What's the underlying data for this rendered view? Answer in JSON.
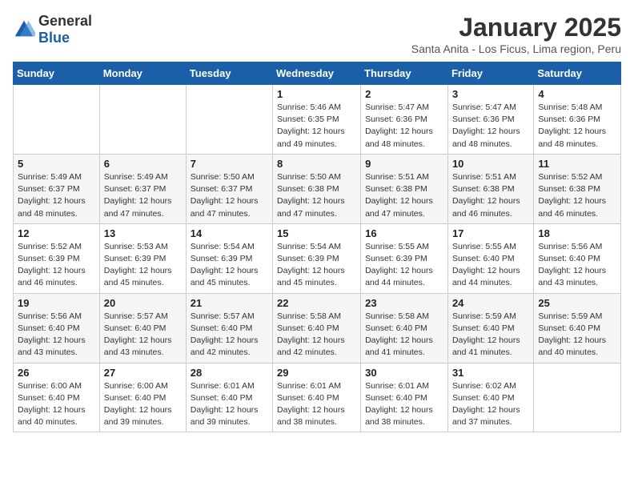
{
  "logo": {
    "general": "General",
    "blue": "Blue"
  },
  "title": "January 2025",
  "subtitle": "Santa Anita - Los Ficus, Lima region, Peru",
  "weekdays": [
    "Sunday",
    "Monday",
    "Tuesday",
    "Wednesday",
    "Thursday",
    "Friday",
    "Saturday"
  ],
  "weeks": [
    [
      {
        "day": "",
        "sunrise": "",
        "sunset": "",
        "daylight": ""
      },
      {
        "day": "",
        "sunrise": "",
        "sunset": "",
        "daylight": ""
      },
      {
        "day": "",
        "sunrise": "",
        "sunset": "",
        "daylight": ""
      },
      {
        "day": "1",
        "sunrise": "Sunrise: 5:46 AM",
        "sunset": "Sunset: 6:35 PM",
        "daylight": "Daylight: 12 hours and 49 minutes."
      },
      {
        "day": "2",
        "sunrise": "Sunrise: 5:47 AM",
        "sunset": "Sunset: 6:36 PM",
        "daylight": "Daylight: 12 hours and 48 minutes."
      },
      {
        "day": "3",
        "sunrise": "Sunrise: 5:47 AM",
        "sunset": "Sunset: 6:36 PM",
        "daylight": "Daylight: 12 hours and 48 minutes."
      },
      {
        "day": "4",
        "sunrise": "Sunrise: 5:48 AM",
        "sunset": "Sunset: 6:36 PM",
        "daylight": "Daylight: 12 hours and 48 minutes."
      }
    ],
    [
      {
        "day": "5",
        "sunrise": "Sunrise: 5:49 AM",
        "sunset": "Sunset: 6:37 PM",
        "daylight": "Daylight: 12 hours and 48 minutes."
      },
      {
        "day": "6",
        "sunrise": "Sunrise: 5:49 AM",
        "sunset": "Sunset: 6:37 PM",
        "daylight": "Daylight: 12 hours and 47 minutes."
      },
      {
        "day": "7",
        "sunrise": "Sunrise: 5:50 AM",
        "sunset": "Sunset: 6:37 PM",
        "daylight": "Daylight: 12 hours and 47 minutes."
      },
      {
        "day": "8",
        "sunrise": "Sunrise: 5:50 AM",
        "sunset": "Sunset: 6:38 PM",
        "daylight": "Daylight: 12 hours and 47 minutes."
      },
      {
        "day": "9",
        "sunrise": "Sunrise: 5:51 AM",
        "sunset": "Sunset: 6:38 PM",
        "daylight": "Daylight: 12 hours and 47 minutes."
      },
      {
        "day": "10",
        "sunrise": "Sunrise: 5:51 AM",
        "sunset": "Sunset: 6:38 PM",
        "daylight": "Daylight: 12 hours and 46 minutes."
      },
      {
        "day": "11",
        "sunrise": "Sunrise: 5:52 AM",
        "sunset": "Sunset: 6:38 PM",
        "daylight": "Daylight: 12 hours and 46 minutes."
      }
    ],
    [
      {
        "day": "12",
        "sunrise": "Sunrise: 5:52 AM",
        "sunset": "Sunset: 6:39 PM",
        "daylight": "Daylight: 12 hours and 46 minutes."
      },
      {
        "day": "13",
        "sunrise": "Sunrise: 5:53 AM",
        "sunset": "Sunset: 6:39 PM",
        "daylight": "Daylight: 12 hours and 45 minutes."
      },
      {
        "day": "14",
        "sunrise": "Sunrise: 5:54 AM",
        "sunset": "Sunset: 6:39 PM",
        "daylight": "Daylight: 12 hours and 45 minutes."
      },
      {
        "day": "15",
        "sunrise": "Sunrise: 5:54 AM",
        "sunset": "Sunset: 6:39 PM",
        "daylight": "Daylight: 12 hours and 45 minutes."
      },
      {
        "day": "16",
        "sunrise": "Sunrise: 5:55 AM",
        "sunset": "Sunset: 6:39 PM",
        "daylight": "Daylight: 12 hours and 44 minutes."
      },
      {
        "day": "17",
        "sunrise": "Sunrise: 5:55 AM",
        "sunset": "Sunset: 6:40 PM",
        "daylight": "Daylight: 12 hours and 44 minutes."
      },
      {
        "day": "18",
        "sunrise": "Sunrise: 5:56 AM",
        "sunset": "Sunset: 6:40 PM",
        "daylight": "Daylight: 12 hours and 43 minutes."
      }
    ],
    [
      {
        "day": "19",
        "sunrise": "Sunrise: 5:56 AM",
        "sunset": "Sunset: 6:40 PM",
        "daylight": "Daylight: 12 hours and 43 minutes."
      },
      {
        "day": "20",
        "sunrise": "Sunrise: 5:57 AM",
        "sunset": "Sunset: 6:40 PM",
        "daylight": "Daylight: 12 hours and 43 minutes."
      },
      {
        "day": "21",
        "sunrise": "Sunrise: 5:57 AM",
        "sunset": "Sunset: 6:40 PM",
        "daylight": "Daylight: 12 hours and 42 minutes."
      },
      {
        "day": "22",
        "sunrise": "Sunrise: 5:58 AM",
        "sunset": "Sunset: 6:40 PM",
        "daylight": "Daylight: 12 hours and 42 minutes."
      },
      {
        "day": "23",
        "sunrise": "Sunrise: 5:58 AM",
        "sunset": "Sunset: 6:40 PM",
        "daylight": "Daylight: 12 hours and 41 minutes."
      },
      {
        "day": "24",
        "sunrise": "Sunrise: 5:59 AM",
        "sunset": "Sunset: 6:40 PM",
        "daylight": "Daylight: 12 hours and 41 minutes."
      },
      {
        "day": "25",
        "sunrise": "Sunrise: 5:59 AM",
        "sunset": "Sunset: 6:40 PM",
        "daylight": "Daylight: 12 hours and 40 minutes."
      }
    ],
    [
      {
        "day": "26",
        "sunrise": "Sunrise: 6:00 AM",
        "sunset": "Sunset: 6:40 PM",
        "daylight": "Daylight: 12 hours and 40 minutes."
      },
      {
        "day": "27",
        "sunrise": "Sunrise: 6:00 AM",
        "sunset": "Sunset: 6:40 PM",
        "daylight": "Daylight: 12 hours and 39 minutes."
      },
      {
        "day": "28",
        "sunrise": "Sunrise: 6:01 AM",
        "sunset": "Sunset: 6:40 PM",
        "daylight": "Daylight: 12 hours and 39 minutes."
      },
      {
        "day": "29",
        "sunrise": "Sunrise: 6:01 AM",
        "sunset": "Sunset: 6:40 PM",
        "daylight": "Daylight: 12 hours and 38 minutes."
      },
      {
        "day": "30",
        "sunrise": "Sunrise: 6:01 AM",
        "sunset": "Sunset: 6:40 PM",
        "daylight": "Daylight: 12 hours and 38 minutes."
      },
      {
        "day": "31",
        "sunrise": "Sunrise: 6:02 AM",
        "sunset": "Sunset: 6:40 PM",
        "daylight": "Daylight: 12 hours and 37 minutes."
      },
      {
        "day": "",
        "sunrise": "",
        "sunset": "",
        "daylight": ""
      }
    ]
  ]
}
